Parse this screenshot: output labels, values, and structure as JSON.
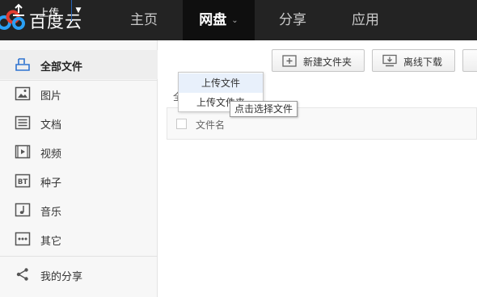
{
  "brand": {
    "name": "百度云",
    "icon": "baidu-cloud-logo"
  },
  "nav": [
    {
      "label": "主页",
      "active": false
    },
    {
      "label": "网盘",
      "active": true,
      "caret": "⌄"
    },
    {
      "label": "分享",
      "active": false
    },
    {
      "label": "应用",
      "active": false
    }
  ],
  "sidebar": {
    "items": [
      {
        "label": "全部文件",
        "icon": "all-files-icon",
        "active": true
      },
      {
        "label": "图片",
        "icon": "image-icon"
      },
      {
        "label": "文档",
        "icon": "document-icon"
      },
      {
        "label": "视频",
        "icon": "video-icon"
      },
      {
        "label": "种子",
        "icon": "bt-torrent-icon",
        "icon_text": "BT"
      },
      {
        "label": "音乐",
        "icon": "music-icon"
      },
      {
        "label": "其它",
        "icon": "other-icon"
      },
      {
        "label": "我的分享",
        "icon": "share-icon"
      }
    ]
  },
  "toolbar": {
    "upload_label": "上传",
    "upload_caret": "▼",
    "new_folder_label": "新建文件夹",
    "offline_download_label": "离线下载"
  },
  "upload_menu": {
    "items": [
      "上传文件",
      "上传文件夹"
    ]
  },
  "tooltip": "点击选择文件",
  "breadcrumb": "全",
  "file_list": {
    "column_name": "文件名"
  },
  "colors": {
    "topbar": "#232323",
    "accent": "#2f73d0"
  }
}
